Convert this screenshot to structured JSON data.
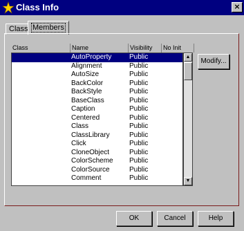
{
  "window": {
    "title": "Class Info",
    "close_glyph": "×"
  },
  "tabs": [
    {
      "label": "Class"
    },
    {
      "label": "Members"
    }
  ],
  "list": {
    "columns": [
      "Class",
      "Name",
      "Visibility",
      "No Init"
    ],
    "rows": [
      {
        "class": "",
        "name": "AutoProperty",
        "visibility": "Public",
        "selected": true
      },
      {
        "class": "",
        "name": "Alignment",
        "visibility": "Public"
      },
      {
        "class": "",
        "name": "AutoSize",
        "visibility": "Public"
      },
      {
        "class": "",
        "name": "BackColor",
        "visibility": "Public"
      },
      {
        "class": "",
        "name": "BackStyle",
        "visibility": "Public"
      },
      {
        "class": "",
        "name": "BaseClass",
        "visibility": "Public"
      },
      {
        "class": "",
        "name": "Caption",
        "visibility": "Public"
      },
      {
        "class": "",
        "name": "Centered",
        "visibility": "Public"
      },
      {
        "class": "",
        "name": "Class",
        "visibility": "Public"
      },
      {
        "class": "",
        "name": "ClassLibrary",
        "visibility": "Public"
      },
      {
        "class": "",
        "name": "Click",
        "visibility": "Public"
      },
      {
        "class": "",
        "name": "CloneObject",
        "visibility": "Public"
      },
      {
        "class": "",
        "name": "ColorScheme",
        "visibility": "Public"
      },
      {
        "class": "",
        "name": "ColorSource",
        "visibility": "Public"
      },
      {
        "class": "",
        "name": "Comment",
        "visibility": "Public"
      }
    ]
  },
  "buttons": {
    "modify": "Modify...",
    "ok": "OK",
    "cancel": "Cancel",
    "help": "Help"
  },
  "colors": {
    "titlebar": "#000080",
    "face": "#c0c0c0",
    "selection": "#000080",
    "panel_border": "#7a1a1a"
  }
}
